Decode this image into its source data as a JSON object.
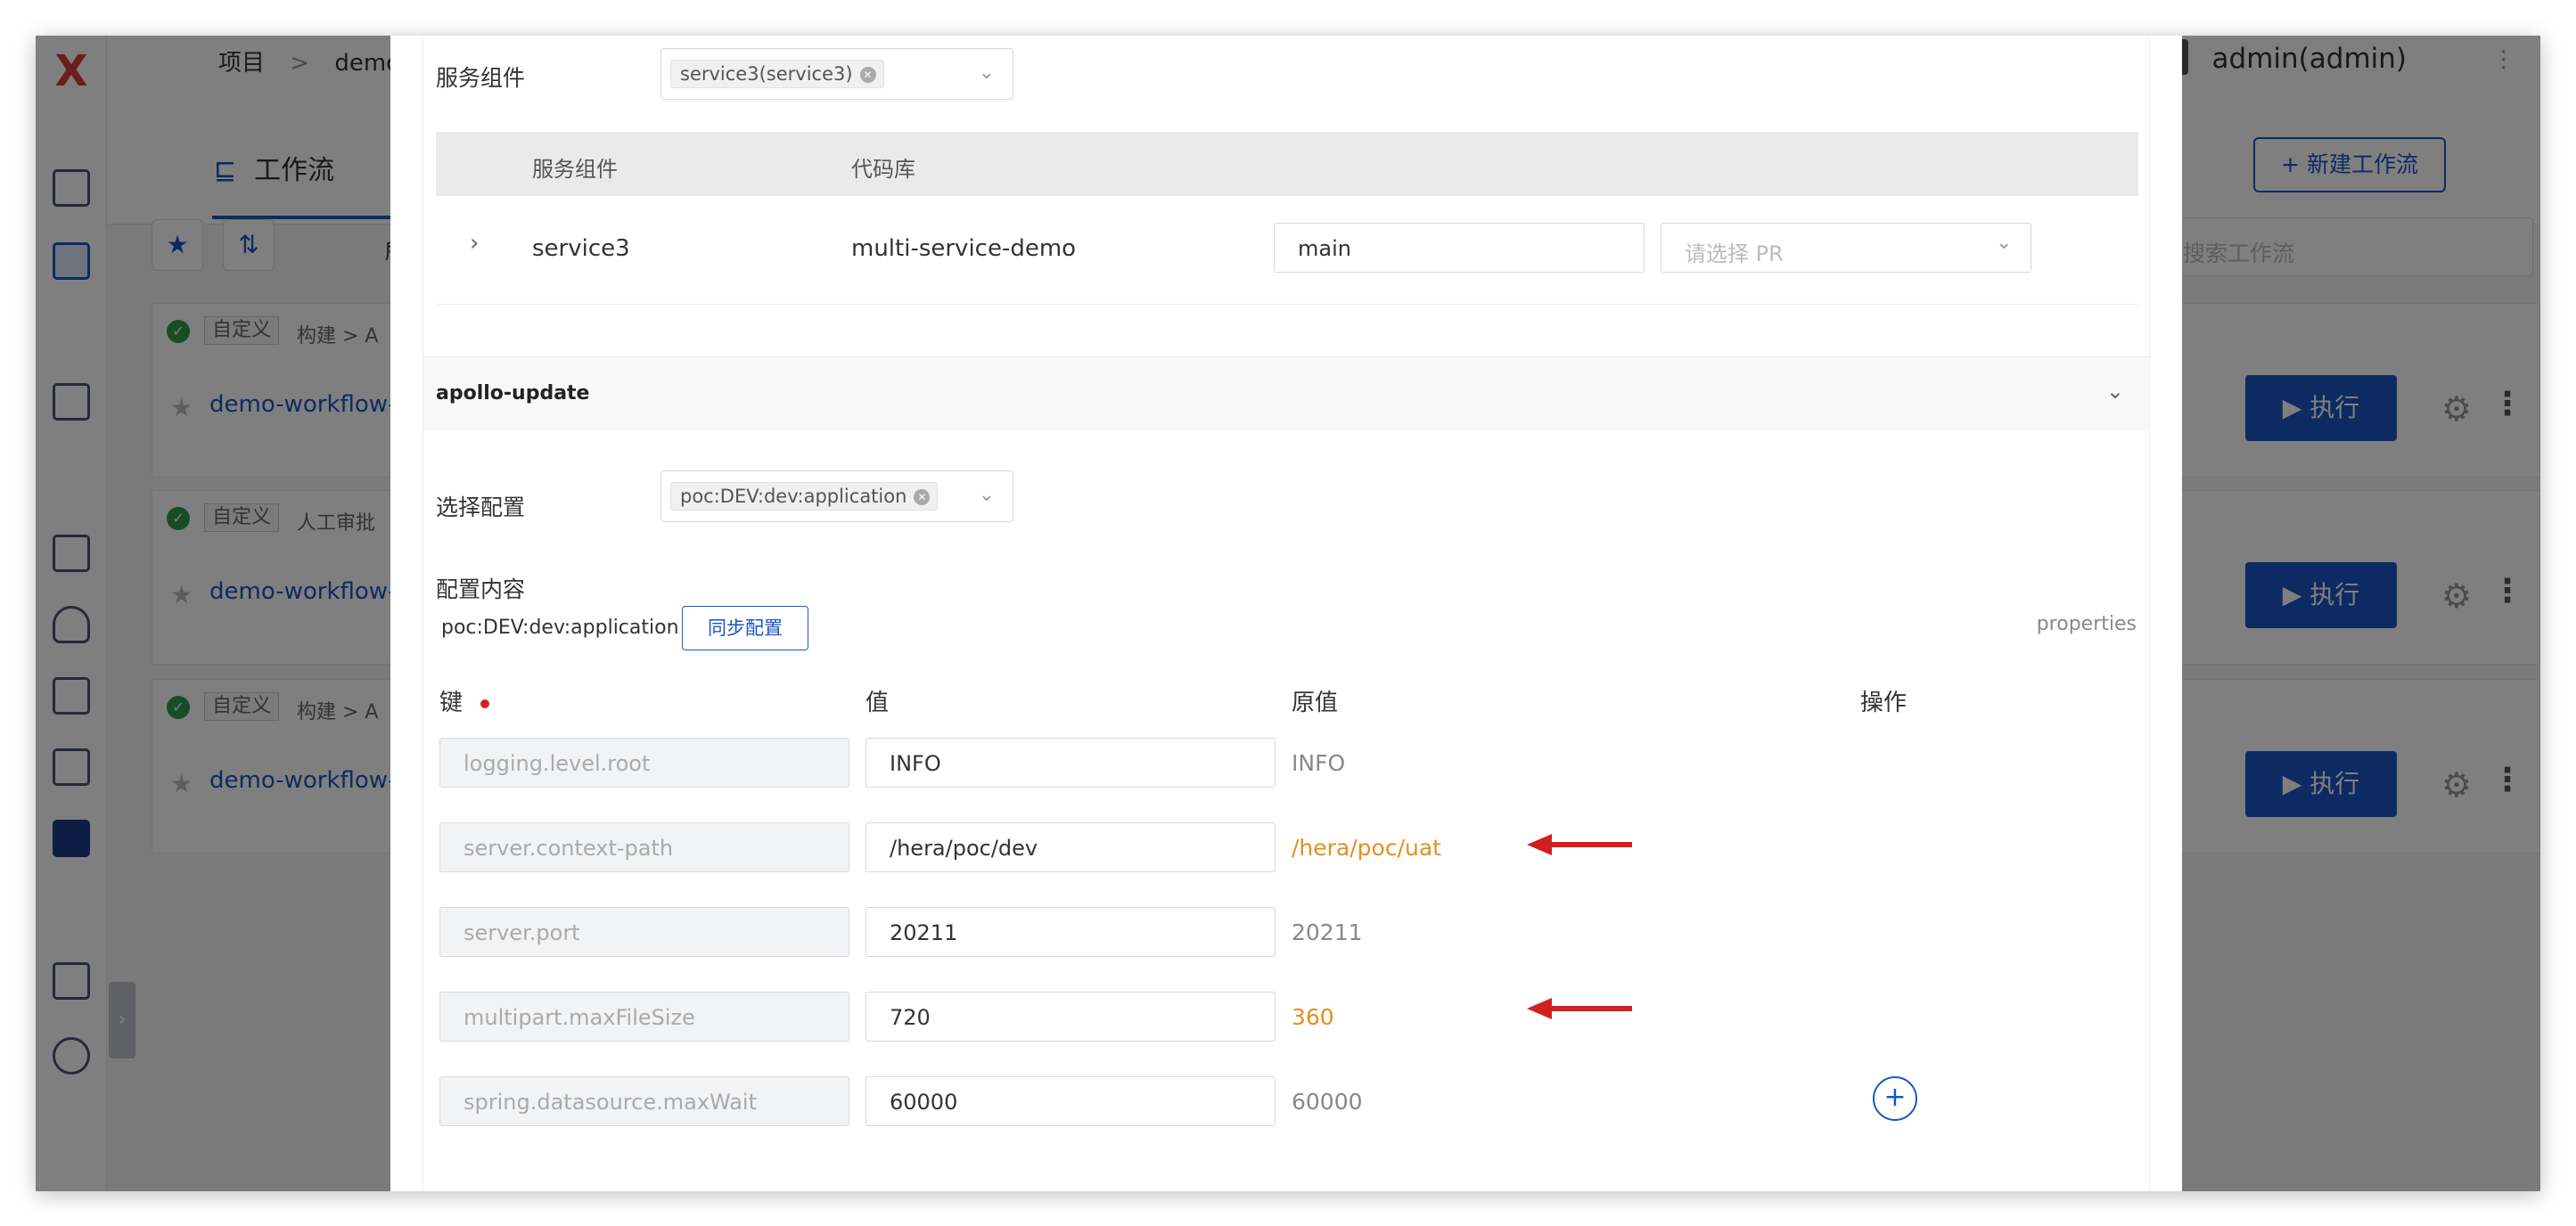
{
  "app": {
    "logo_glyph": "X",
    "user": "admin(admin)"
  },
  "breadcrumb": {
    "project": "项目",
    "sep": ">",
    "demo": "demo",
    "caret": "▼",
    "sep2": ">"
  },
  "tabs": {
    "workflow": "工作流",
    "new_button": "+ 新建工作流"
  },
  "filters": {
    "all": "所有",
    "search_placeholder": "搜索工作流"
  },
  "workflows": [
    {
      "tag": "自定义",
      "stage": "构建 > A",
      "name": "demo-workflow-d"
    },
    {
      "tag": "自定义",
      "stage": "人工审批",
      "name": "demo-workflow-p"
    },
    {
      "tag": "自定义",
      "stage": "构建 > A",
      "name": "demo-workflow-si"
    }
  ],
  "run_label": "执行",
  "modal": {
    "service_label": "服务组件",
    "service_chip": "service3(service3)",
    "table_headers": {
      "service": "服务组件",
      "repo": "代码库"
    },
    "row": {
      "service": "service3",
      "repo": "multi-service-demo",
      "branch": "main",
      "pr_placeholder": "请选择 PR"
    },
    "section_title": "apollo-update",
    "config_label": "选择配置",
    "config_chip": "poc:DEV:dev:application",
    "content_label": "配置内容",
    "config_name": "poc:DEV:dev:application",
    "sync_button": "同步配置",
    "format": "properties",
    "columns": {
      "key": "键",
      "value": "值",
      "original": "原值",
      "action": "操作"
    },
    "rows": [
      {
        "key": "logging.level.root",
        "value": "INFO",
        "original": "INFO",
        "changed": false
      },
      {
        "key": "server.context-path",
        "value": "/hera/poc/dev",
        "original": "/hera/poc/uat",
        "changed": true
      },
      {
        "key": "server.port",
        "value": "20211",
        "original": "20211",
        "changed": false
      },
      {
        "key": "multipart.maxFileSize",
        "value": "720",
        "original": "360",
        "changed": true
      },
      {
        "key": "spring.datasource.maxWait",
        "value": "60000",
        "original": "60000",
        "changed": false
      }
    ],
    "add_label": "+"
  },
  "colors": {
    "accent": "#1a55c4",
    "changed": "#e2901c",
    "arrow": "#d12020"
  }
}
